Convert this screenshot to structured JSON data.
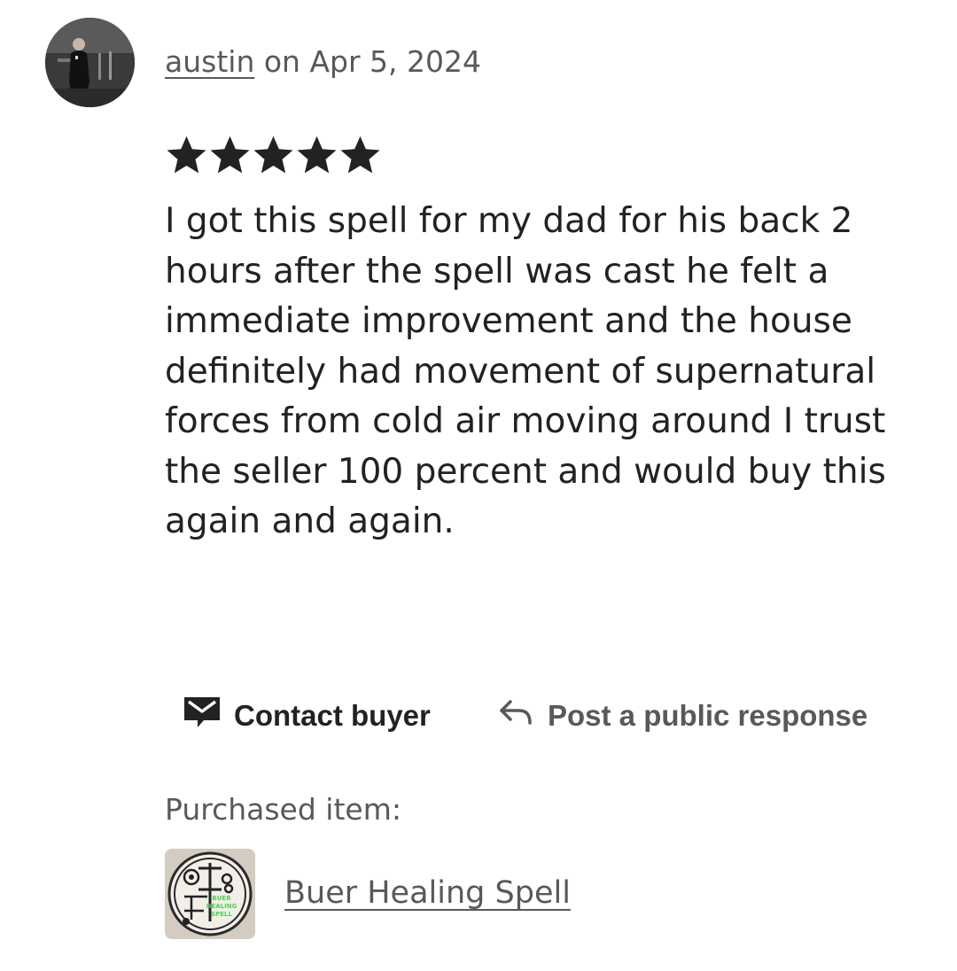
{
  "review": {
    "username": "austin",
    "date_prefix": " on ",
    "date": "Apr 5, 2024",
    "rating": 5,
    "rating_max": 5,
    "text": "I got this spell for my dad for his back 2 hours after the spell was cast he felt a immediate improvement and the house definitely had movement of supernatural forces from cold air moving around I trust the seller 100 percent and would buy this again and again."
  },
  "actions": {
    "contact_label": "Contact buyer",
    "contact_icon": "envelope-icon",
    "respond_label": "Post a public response",
    "respond_icon": "reply-arrow-icon"
  },
  "purchased": {
    "label": "Purchased item:",
    "item_name": "Buer Healing Spell",
    "thumb_text_lines": [
      "BUER",
      "HEALING",
      "SPELL"
    ]
  },
  "colors": {
    "text_primary": "#222222",
    "text_secondary": "#595959",
    "star": "#222222",
    "thumb_green": "#4cd44c"
  }
}
